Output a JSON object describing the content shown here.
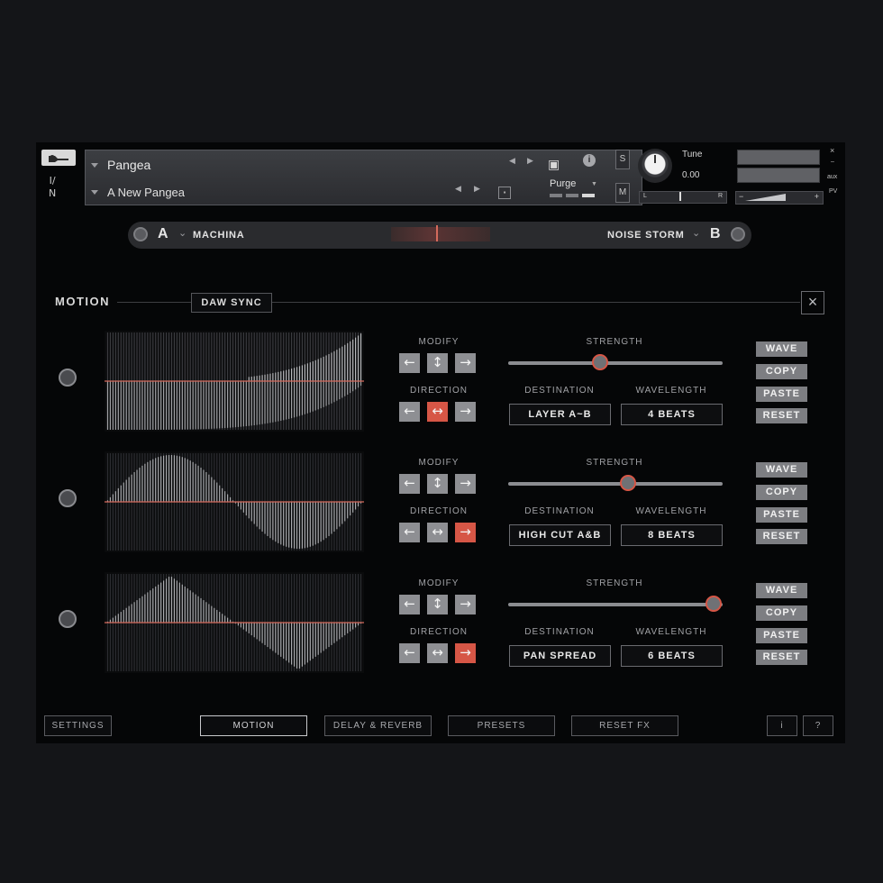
{
  "header": {
    "io_label_top": "I/",
    "io_label_bottom": "N",
    "instrument_name": "Pangea",
    "snapshot_name": "A New Pangea",
    "purge_label": "Purge",
    "solo_label": "S",
    "mute_label": "M",
    "tune_label": "Tune",
    "tune_value": "0.00",
    "pan_left": "L",
    "pan_right": "R",
    "vol_minus": "−",
    "vol_plus": "+",
    "aux_label": "aux",
    "pv_label": "PV",
    "close_glyph": "×",
    "min_glyph": "–"
  },
  "ab": {
    "a_letter": "A",
    "a_name": "MACHINA",
    "b_name": "NOISE STORM",
    "b_letter": "B"
  },
  "motion": {
    "title": "MOTION",
    "daw_sync": "DAW SYNC",
    "close": "×",
    "labels": {
      "modify": "MODIFY",
      "direction": "DIRECTION",
      "strength": "STRENGTH",
      "destination": "DESTINATION",
      "wavelength": "WAVELENGTH"
    },
    "buttons": {
      "wave": "WAVE",
      "copy": "COPY",
      "paste": "PASTE",
      "reset": "RESET"
    },
    "lanes": [
      {
        "shape": "exponential",
        "strength": 0.43,
        "direction_active": "both",
        "destination": "LAYER A~B",
        "wavelength": "4 BEATS"
      },
      {
        "shape": "sine",
        "strength": 0.56,
        "direction_active": "right",
        "destination": "HIGH CUT A&B",
        "wavelength": "8 BEATS"
      },
      {
        "shape": "triangle",
        "strength": 0.96,
        "direction_active": "right",
        "destination": "PAN SPREAD",
        "wavelength": "6 BEATS"
      }
    ]
  },
  "footer": {
    "settings": "SETTINGS",
    "motion": "MOTION",
    "delay_reverb": "DELAY & REVERB",
    "presets": "PRESETS",
    "reset_fx": "RESET FX",
    "info": "i",
    "help": "?"
  },
  "colors": {
    "accent": "#d65646",
    "panel": "#050607",
    "button": "#8e8f93"
  },
  "icons": {
    "wrench": "wrench-icon",
    "camera": "camera-icon",
    "left": "arrow-left-icon",
    "updown": "arrow-up-down-icon",
    "right": "arrow-right-icon",
    "both": "arrow-left-right-icon"
  }
}
